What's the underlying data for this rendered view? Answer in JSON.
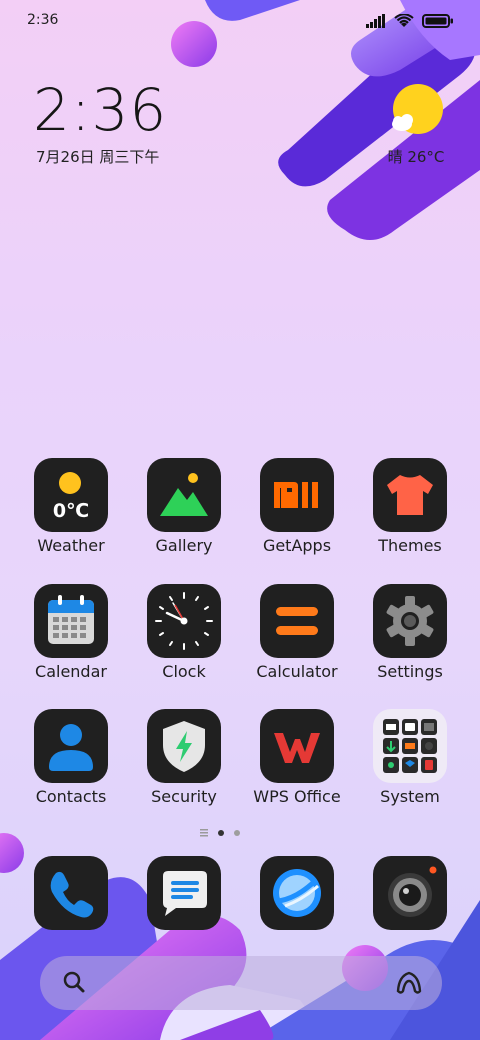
{
  "status_bar": {
    "time": "2:36",
    "icons": [
      "signal-icon",
      "wifi-icon",
      "battery-icon"
    ]
  },
  "clock_widget": {
    "time": "2:36",
    "date": "7月26日 周三下午"
  },
  "weather_widget": {
    "condition_icon": "sunny-cloud-icon",
    "text": "晴 26°C"
  },
  "apps": [
    {
      "label": "Weather",
      "icon": "weather-icon",
      "icon_text": "0℃"
    },
    {
      "label": "Gallery",
      "icon": "gallery-icon"
    },
    {
      "label": "GetApps",
      "icon": "getapps-icon"
    },
    {
      "label": "Themes",
      "icon": "themes-icon"
    },
    {
      "label": "Calendar",
      "icon": "calendar-icon"
    },
    {
      "label": "Clock",
      "icon": "clock-icon"
    },
    {
      "label": "Calculator",
      "icon": "calculator-icon"
    },
    {
      "label": "Settings",
      "icon": "settings-icon"
    },
    {
      "label": "Contacts",
      "icon": "contacts-icon"
    },
    {
      "label": "Security",
      "icon": "security-icon"
    },
    {
      "label": "WPS Office",
      "icon": "wps-office-icon"
    },
    {
      "label": "System",
      "icon": "system-folder-icon"
    }
  ],
  "page_indicator": {
    "pages": 2,
    "active": 1,
    "has_menu": true
  },
  "dock": [
    {
      "icon": "phone-icon"
    },
    {
      "icon": "messages-icon"
    },
    {
      "icon": "browser-icon"
    },
    {
      "icon": "camera-icon"
    }
  ],
  "search_bar": {
    "left_icon": "search-icon",
    "right_icon": "assistant-icon"
  },
  "colors": {
    "accent_purple": "#6a2fe0",
    "icon_bg": "#202020",
    "xiaomi_orange": "#ff6900",
    "sun_yellow": "#ffd21e"
  }
}
